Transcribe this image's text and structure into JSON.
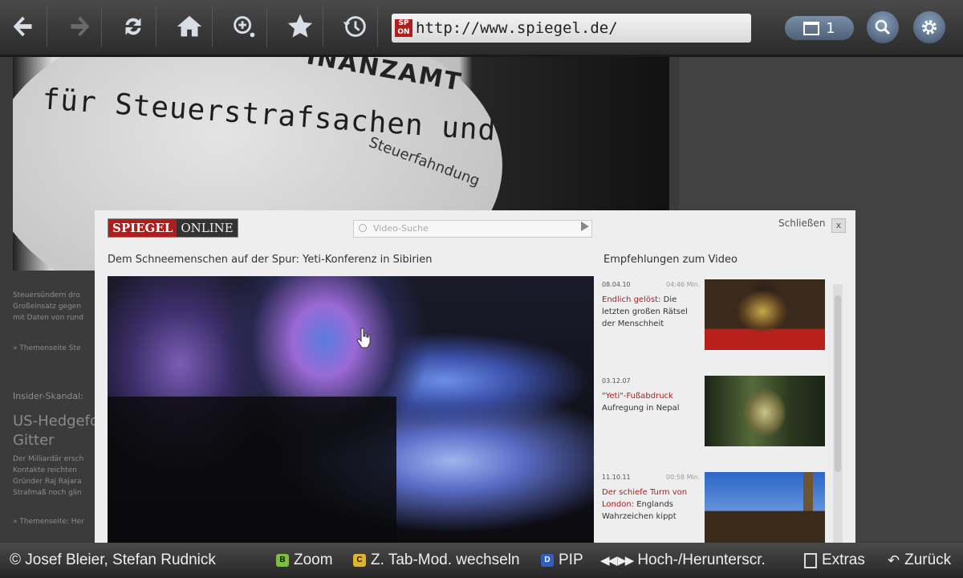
{
  "toolbar": {
    "buttons": [
      "back-icon",
      "forward-icon",
      "refresh-icon",
      "home-icon",
      "zoom-icon",
      "bookmark-star-icon",
      "history-icon"
    ],
    "favicon_text": "SP ON",
    "url": "http://www.spiegel.de/",
    "tab_count": "1"
  },
  "page": {
    "photo_sign_line1": "INANZAMT",
    "photo_sign_line2": "für Steuerstrafsachen und",
    "photo_sign_line3": "Steuerfahndung",
    "side_text_1": [
      "Steuersündern dro",
      "Großeinsatz gegen",
      "mit Daten von rund"
    ],
    "side_link_1": "» Themenseite Ste",
    "side_kicker": "Insider-Skandal:",
    "side_headline": [
      "US-Hedgefon",
      "Gitter"
    ],
    "side_text_2": [
      "Der Milliardär ersch",
      "Kontakte reichten",
      "Gründer Raj Rajara",
      "Strafmaß noch glin"
    ],
    "side_link_2": "» Themenseite: Her"
  },
  "dialog": {
    "logo_a": "SPIEGEL",
    "logo_b": "ONLINE",
    "search_placeholder": "Video-Suche",
    "close_label": "Schließen",
    "close_x": "x",
    "video_title": "Dem Schneemenschen auf der Spur: Yeti-Konferenz in Sibirien",
    "recommend_title": "Empfehlungen zum Video",
    "recommendations": [
      {
        "date": "08.04.10",
        "duration": "04:46 Min.",
        "link": "Endlich gelöst:",
        "text": " Die letzten großen Rätsel der Menschheit"
      },
      {
        "date": "03.12.07",
        "duration": "",
        "link": "\"Yeti\"-Fußabdruck",
        "text": " Aufregung in Nepal"
      },
      {
        "date": "11.10.11",
        "duration": "00:58 Min.",
        "link": "Der schiefe Turm von London:",
        "text": " Englands Wahrzeichen kippt"
      }
    ]
  },
  "bottombar": {
    "copyright": "© Josef Bleier, Stefan Rudnick",
    "key_b": "B",
    "zoom": "Zoom",
    "key_c": "C",
    "tab_mode": "Z. Tab-Mod. wechseln",
    "key_d": "D",
    "pip": "PIP",
    "scroll": "Hoch-/Herunterscr.",
    "extras": "Extras",
    "back": "Zurück"
  },
  "colors": {
    "accent_red": "#b01d1d",
    "key_green": "#7bbf3a",
    "key_yellow": "#e0b52a",
    "key_blue": "#2f5fbf"
  }
}
